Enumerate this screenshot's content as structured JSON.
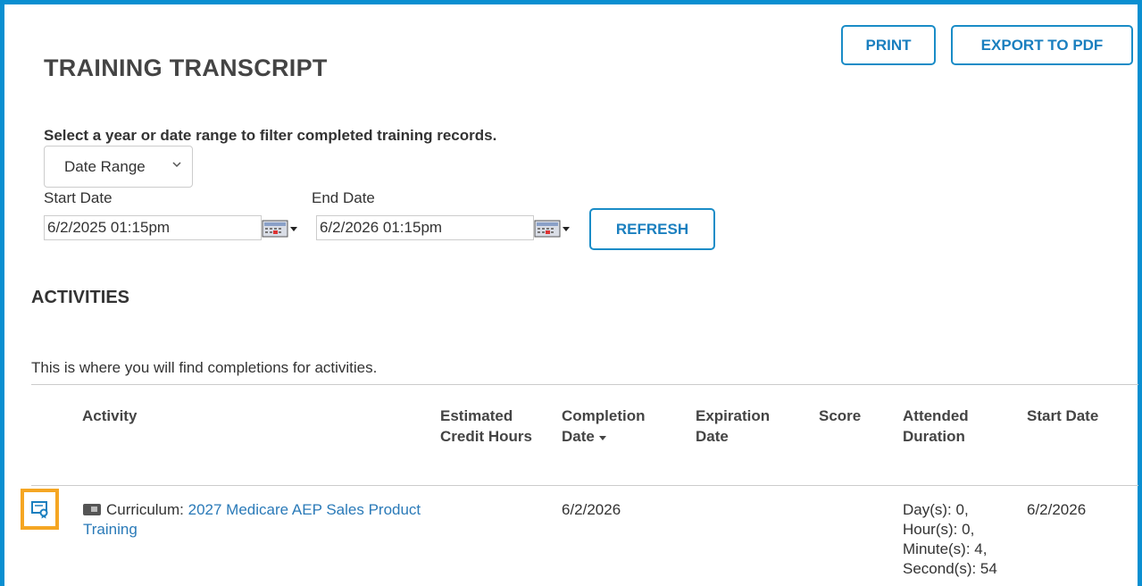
{
  "page": {
    "title": "TRAINING TRANSCRIPT"
  },
  "toolbar": {
    "print_label": "PRINT",
    "export_label": "EXPORT TO PDF"
  },
  "filter": {
    "instruction": "Select a year or date range to filter completed training records.",
    "range_type_selected": "Date Range",
    "start_label": "Start Date",
    "start_value": "6/2/2025 01:15pm",
    "end_label": "End Date",
    "end_value": "6/2/2026 01:15pm",
    "refresh_label": "REFRESH"
  },
  "activities": {
    "title": "ACTIVITIES",
    "description": "This is where you will find completions for activities.",
    "columns": {
      "activity": "Activity",
      "credit_hours": "Estimated Credit Hours",
      "completion_date": "Completion Date",
      "expiration_date": "Expiration Date",
      "score": "Score",
      "attended_duration": "Attended Duration",
      "start_date": "Start Date"
    },
    "rows": [
      {
        "type_prefix": "Curriculum:",
        "title": "2027 Medicare AEP Sales Product Training",
        "credit_hours": "",
        "completion_date": "6/2/2026",
        "expiration_date": "",
        "score": "",
        "attended_duration": "Day(s): 0, Hour(s): 0, Minute(s): 4, Second(s): 54",
        "start_date": "6/2/2026"
      }
    ]
  },
  "colors": {
    "frame_border": "#0a8fd1",
    "button_accent": "#1a8cc7",
    "link": "#2a7ab8",
    "highlight": "#f5a623"
  },
  "icons": {
    "range_select": "chevron-down-icon",
    "date_picker": "calendar-icon",
    "sort": "sort-descending-icon",
    "certificate": "certificate-icon",
    "activity_type": "curriculum-icon"
  }
}
